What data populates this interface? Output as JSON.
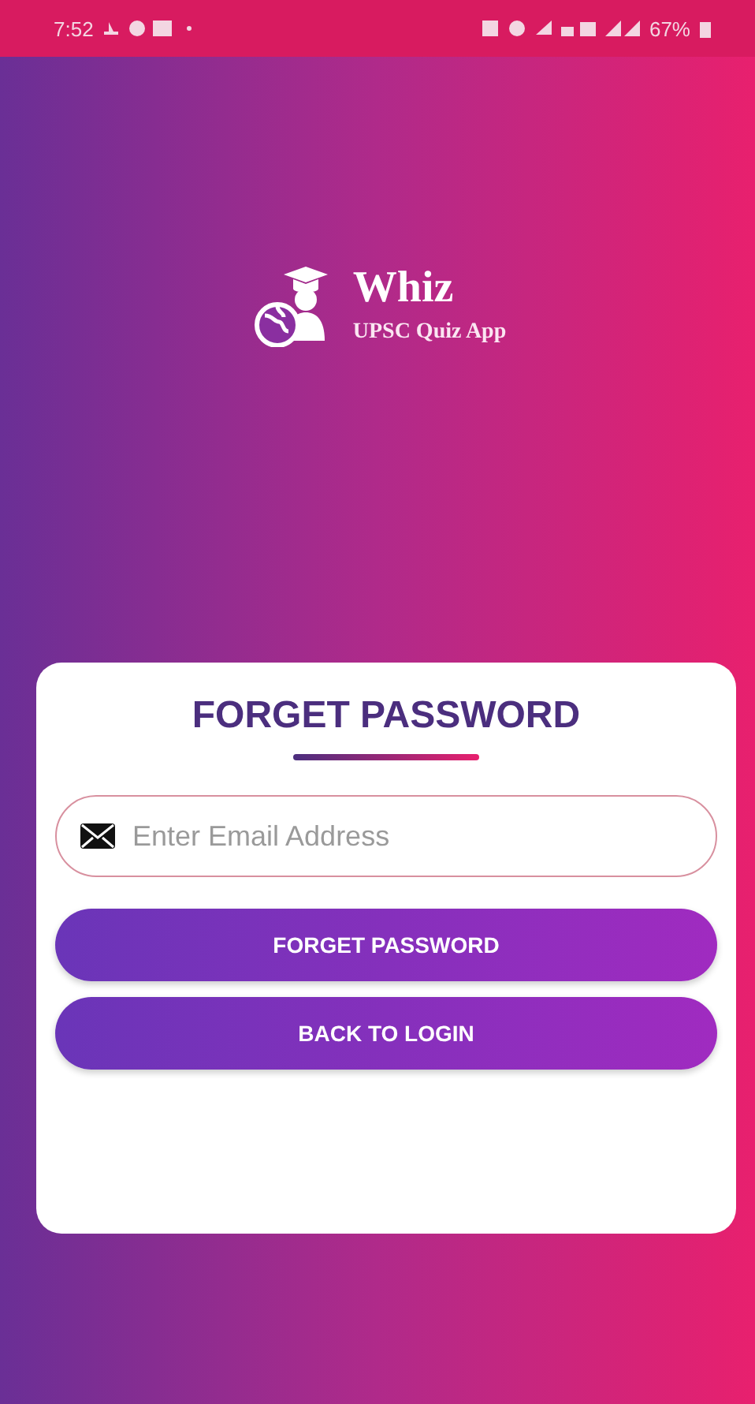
{
  "status_bar": {
    "time": "7:52",
    "battery": "67%"
  },
  "logo": {
    "title": "Whiz",
    "subtitle": "UPSC Quiz App"
  },
  "card": {
    "title": "FORGET PASSWORD",
    "email_field": {
      "placeholder": "Enter Email Address"
    },
    "buttons": [
      "FORGET PASSWORD",
      "BACK TO LOGIN"
    ]
  }
}
